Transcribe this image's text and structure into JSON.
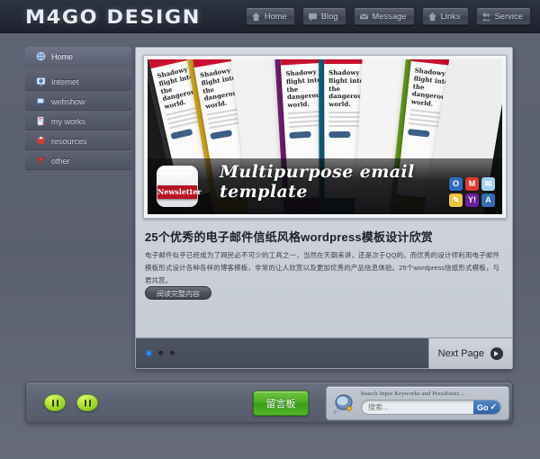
{
  "site": {
    "logo": "M4GO DESIGN"
  },
  "nav": {
    "items": [
      {
        "label": "Home",
        "icon": "house-icon"
      },
      {
        "label": "Blog",
        "icon": "speech-bubble-icon"
      },
      {
        "label": "Message",
        "icon": "envelope-icon"
      },
      {
        "label": "Links",
        "icon": "house-icon"
      },
      {
        "label": "Service",
        "icon": "people-icon"
      }
    ]
  },
  "sidebar": {
    "items": [
      {
        "label": "Home",
        "icon": "home-globe-icon",
        "active": true
      },
      {
        "label": "Internet",
        "icon": "internet-icon",
        "active": false
      },
      {
        "label": "webshow",
        "icon": "webshow-icon",
        "active": false
      },
      {
        "label": "my works",
        "icon": "my-works-icon",
        "active": false
      },
      {
        "label": "resources",
        "icon": "resources-icon",
        "active": false
      },
      {
        "label": "other",
        "icon": "other-icon",
        "active": false
      }
    ]
  },
  "banner": {
    "badge": "Newsletter",
    "title": "Multipurpose email template",
    "card_heading": "Shadowy flight into the dangerous world.",
    "sheet_colors": [
      "#2e2e30",
      "#c9a21a",
      "#f1f1f1",
      "#6c1b6e",
      "#0d5f7a",
      "#f4f4f4",
      "#5f9216",
      "#ededed"
    ],
    "mail_icons": [
      "outlook-icon",
      "gmail-icon",
      "mail-app-icon",
      "notes-icon",
      "yahoo-icon",
      "aol-icon"
    ]
  },
  "post": {
    "title": "25个优秀的电子邮件信纸风格wordpress模板设计欣赏",
    "body": "电子邮件似乎已经成为了网民必不可少的工具之一，当然在天朝来讲，还是次于QQ的。而优秀的设计师利用电子邮件模板形式设计各种各样的博客模板，非常的让人欣赏以及更加优秀的产品信息体验。25个wordpress信纸形式模板，与君共赏。",
    "read_more": "阅读完整内容"
  },
  "pager": {
    "dots": [
      true,
      false,
      false
    ],
    "next_label": "Next Page",
    "next_icon": "circle-arrow-right-icon"
  },
  "footer": {
    "bean_buttons": [
      "pause-bean-icon",
      "pause-bean-icon"
    ],
    "message_board": "留言板",
    "search": {
      "icon": "magnifier-icon",
      "label": "Search Input Keyworks and PressEnter....",
      "placeholder": "搜索...",
      "button": "Go",
      "check": "✓"
    }
  },
  "colors": {
    "page_bg": "#5b6070",
    "header_bg": "#262b38",
    "panel_bg": "#ccd1d9",
    "accent_blue": "#2b8cff",
    "green": "#4cab22"
  }
}
